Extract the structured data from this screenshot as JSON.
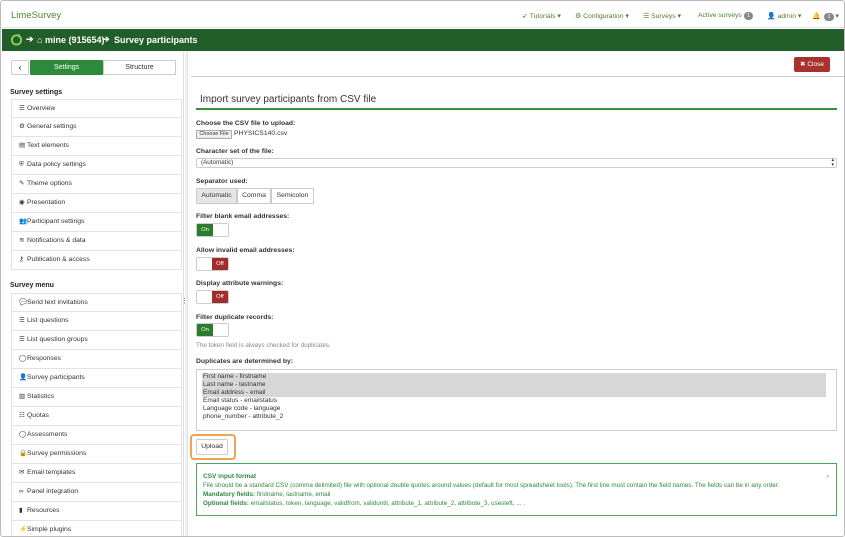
{
  "topnav": {
    "brand": "LimeSurvey",
    "tutorials": "Tutorials",
    "configuration": "Configuration",
    "surveys": "Surveys",
    "active_surveys": "Active surveys",
    "active_surveys_count": "1",
    "admin": "admin",
    "notifications_count": "1"
  },
  "breadcrumb": {
    "survey": "mine (915654)",
    "page": "Survey participants"
  },
  "sidebar": {
    "settings_tab": "Settings",
    "structure_tab": "Structure",
    "settings_heading": "Survey settings",
    "settings_items": [
      {
        "icon": "list-icon",
        "label": "Overview"
      },
      {
        "icon": "cogs-icon",
        "label": "General settings"
      },
      {
        "icon": "file-text-icon",
        "label": "Text elements"
      },
      {
        "icon": "shield-icon",
        "label": "Data policy settings"
      },
      {
        "icon": "brush-icon",
        "label": "Theme options"
      },
      {
        "icon": "eye-icon",
        "label": "Presentation"
      },
      {
        "icon": "users-icon",
        "label": "Participant settings"
      },
      {
        "icon": "rss-icon",
        "label": "Notifications & data"
      },
      {
        "icon": "key-icon",
        "label": "Publication & access"
      }
    ],
    "menu_heading": "Survey menu",
    "menu_items": [
      {
        "icon": "comment-icon",
        "label": "Send text invitations"
      },
      {
        "icon": "list-icon",
        "label": "List questions"
      },
      {
        "icon": "list-icon",
        "label": "List question groups"
      },
      {
        "icon": "comment-o-icon",
        "label": "Responses"
      },
      {
        "icon": "user-icon",
        "label": "Survey participants"
      },
      {
        "icon": "bar-chart-icon",
        "label": "Statistics"
      },
      {
        "icon": "tasks-icon",
        "label": "Quotas"
      },
      {
        "icon": "comment-o-icon",
        "label": "Assessments"
      },
      {
        "icon": "lock-icon",
        "label": "Survey permissions"
      },
      {
        "icon": "envelope-icon",
        "label": "Email templates"
      },
      {
        "icon": "link-icon",
        "label": "Panel integration"
      },
      {
        "icon": "file-icon",
        "label": "Resources"
      },
      {
        "icon": "plug-icon",
        "label": "Simple plugins"
      }
    ]
  },
  "main": {
    "close_label": "Close",
    "title": "Import survey participants from CSV file",
    "file_label": "Choose the CSV file to upload:",
    "choose_file_button": "Choose File",
    "file_name": "PHYSICS140.csv",
    "charset_label": "Character set of the file:",
    "charset_value": "(Automatic)",
    "separator_label": "Separator used:",
    "separator_options": [
      "Automatic",
      "Comma",
      "Semicolon"
    ],
    "separator_selected": "Automatic",
    "filter_blank_label": "Filter blank email addresses:",
    "filter_blank_state": "On",
    "allow_invalid_label": "Allow invalid email addresses:",
    "allow_invalid_state": "Off",
    "display_attr_label": "Display attribute warnings:",
    "display_attr_state": "Off",
    "filter_dup_label": "Filter duplicate records:",
    "filter_dup_state": "On",
    "token_help": "The token field is always checked for duplicates.",
    "duplicates_label": "Duplicates are determined by:",
    "duplicate_options": [
      {
        "label": "First name - firstname",
        "selected": true
      },
      {
        "label": "Last name - lastname",
        "selected": true
      },
      {
        "label": "Email address - email",
        "selected": true
      },
      {
        "label": "Email status - emailstatus",
        "selected": false
      },
      {
        "label": "Language code - language",
        "selected": false
      },
      {
        "label": "phone_number - attribute_2",
        "selected": false
      }
    ],
    "upload_label": "Upload",
    "info": {
      "title": "CSV input format",
      "body": "File should be a standard CSV (comma delimited) file with optional double quotes around values (default for most spreadsheet tools). The first line must contain the field names. The fields can be in any order.",
      "mandatory_label": "Mandatory fields:",
      "mandatory_fields": "firstname, lastname, email",
      "optional_label": "Optional fields:",
      "optional_fields": "emailstatus, token, language, validfrom, validuntil, attribute_1, attribute_2, attribute_3, usesleft, ... ."
    }
  },
  "colors": {
    "brand_green": "#225e2a",
    "active_tab": "#2b8b3b",
    "toggle_on": "#2b7c2c",
    "toggle_off": "#a12d2b",
    "close_button": "#a8322d",
    "upload_highlight": "#f0a451"
  }
}
